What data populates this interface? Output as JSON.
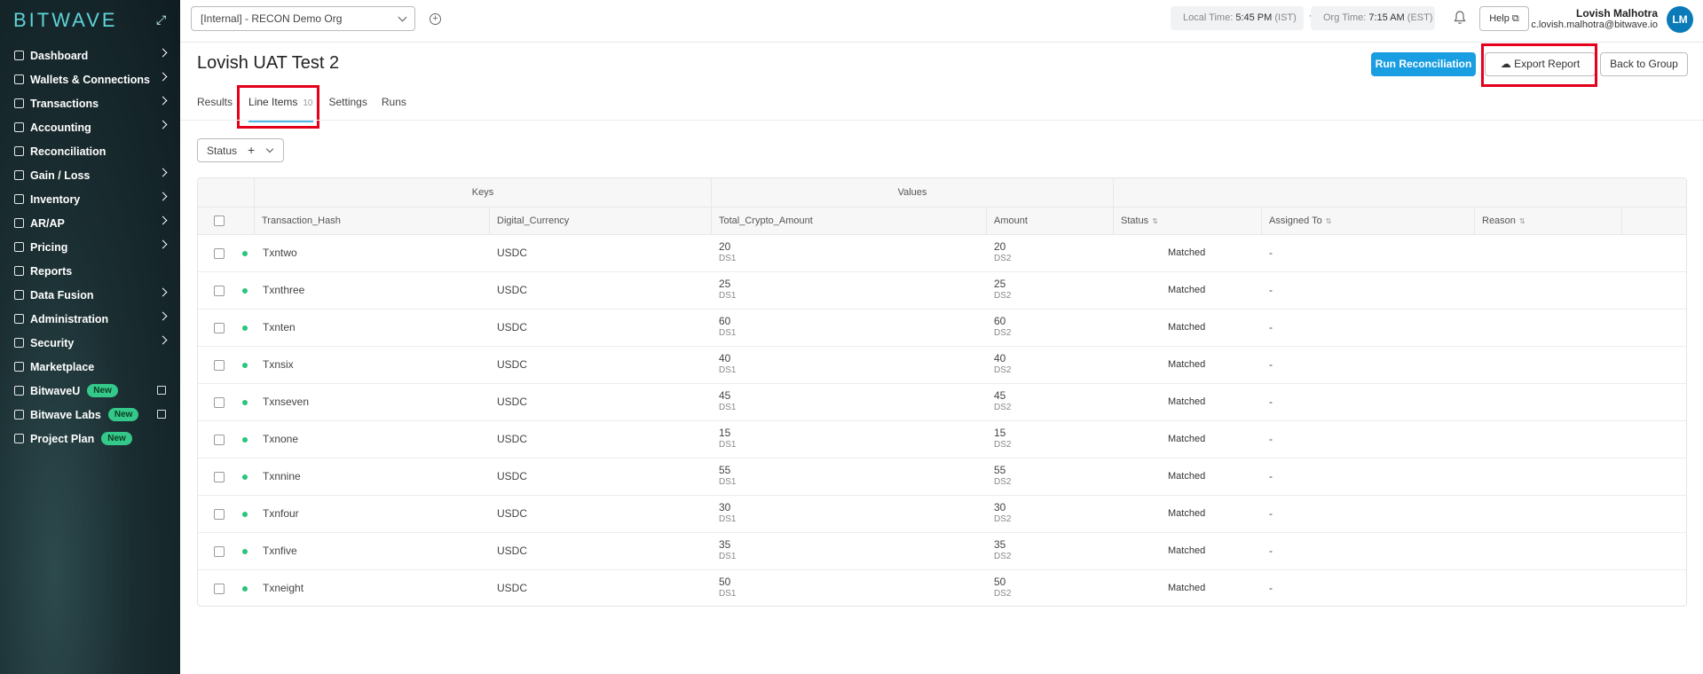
{
  "app": {
    "logo": "BITWAVE"
  },
  "sidebar": {
    "items": [
      {
        "label": "Dashboard",
        "chevron": true
      },
      {
        "label": "Wallets & Connections",
        "chevron": true
      },
      {
        "label": "Transactions",
        "chevron": true
      },
      {
        "label": "Accounting",
        "chevron": true
      },
      {
        "label": "Reconciliation",
        "chevron": false
      },
      {
        "label": "Gain / Loss",
        "chevron": true
      },
      {
        "label": "Inventory",
        "chevron": true
      },
      {
        "label": "AR/AP",
        "chevron": true
      },
      {
        "label": "Pricing",
        "chevron": true
      },
      {
        "label": "Reports",
        "chevron": false
      },
      {
        "label": "Data Fusion",
        "chevron": true
      },
      {
        "label": "Administration",
        "chevron": true
      },
      {
        "label": "Security",
        "chevron": true
      },
      {
        "label": "Marketplace",
        "chevron": false
      },
      {
        "label": "BitwaveU",
        "badge": "New",
        "external": true
      },
      {
        "label": "Bitwave Labs",
        "badge": "New",
        "external": true
      },
      {
        "label": "Project Plan",
        "badge": "New"
      }
    ]
  },
  "topbar": {
    "org": "[Internal] - RECON Demo Org",
    "local_time_label": "Local Time:",
    "local_time": "5:45 PM",
    "local_tz": "(IST)",
    "org_time_label": "Org Time:",
    "org_time": "7:15 AM",
    "org_tz": "(EST)",
    "help": "Help",
    "user_name": "Lovish Malhotra",
    "user_email": "c.lovish.malhotra@bitwave.io",
    "avatar": "LM"
  },
  "page": {
    "title": "Lovish UAT Test 2",
    "run": "Run Reconciliation",
    "export": "Export Report",
    "back": "Back to Group",
    "tabs": [
      {
        "label": "Results"
      },
      {
        "label": "Line Items",
        "count": "10"
      },
      {
        "label": "Settings"
      },
      {
        "label": "Runs"
      }
    ],
    "filter": "Status"
  },
  "table": {
    "groups": {
      "keys": "Keys",
      "values": "Values"
    },
    "headers": [
      "Transaction_Hash",
      "Digital_Currency",
      "Total_Crypto_Amount",
      "Amount",
      "Status",
      "Assigned To",
      "Reason"
    ],
    "rows": [
      {
        "hash": "Txntwo",
        "cur": "USDC",
        "tca": "20",
        "tca_src": "DS1",
        "amt": "20",
        "amt_src": "DS2",
        "status": "Matched",
        "assigned": "-"
      },
      {
        "hash": "Txnthree",
        "cur": "USDC",
        "tca": "25",
        "tca_src": "DS1",
        "amt": "25",
        "amt_src": "DS2",
        "status": "Matched",
        "assigned": "-"
      },
      {
        "hash": "Txnten",
        "cur": "USDC",
        "tca": "60",
        "tca_src": "DS1",
        "amt": "60",
        "amt_src": "DS2",
        "status": "Matched",
        "assigned": "-"
      },
      {
        "hash": "Txnsix",
        "cur": "USDC",
        "tca": "40",
        "tca_src": "DS1",
        "amt": "40",
        "amt_src": "DS2",
        "status": "Matched",
        "assigned": "-"
      },
      {
        "hash": "Txnseven",
        "cur": "USDC",
        "tca": "45",
        "tca_src": "DS1",
        "amt": "45",
        "amt_src": "DS2",
        "status": "Matched",
        "assigned": "-"
      },
      {
        "hash": "Txnone",
        "cur": "USDC",
        "tca": "15",
        "tca_src": "DS1",
        "amt": "15",
        "amt_src": "DS2",
        "status": "Matched",
        "assigned": "-"
      },
      {
        "hash": "Txnnine",
        "cur": "USDC",
        "tca": "55",
        "tca_src": "DS1",
        "amt": "55",
        "amt_src": "DS2",
        "status": "Matched",
        "assigned": "-"
      },
      {
        "hash": "Txnfour",
        "cur": "USDC",
        "tca": "30",
        "tca_src": "DS1",
        "amt": "30",
        "amt_src": "DS2",
        "status": "Matched",
        "assigned": "-"
      },
      {
        "hash": "Txnfive",
        "cur": "USDC",
        "tca": "35",
        "tca_src": "DS1",
        "amt": "35",
        "amt_src": "DS2",
        "status": "Matched",
        "assigned": "-"
      },
      {
        "hash": "Txneight",
        "cur": "USDC",
        "tca": "50",
        "tca_src": "DS1",
        "amt": "50",
        "amt_src": "DS2",
        "status": "Matched",
        "assigned": "-"
      }
    ]
  },
  "colors": {
    "accent": "#1a9ee2",
    "highlight": "#e5001c",
    "matched_dot": "#2bc47d",
    "sidebar_bg": "#0f1d22"
  }
}
